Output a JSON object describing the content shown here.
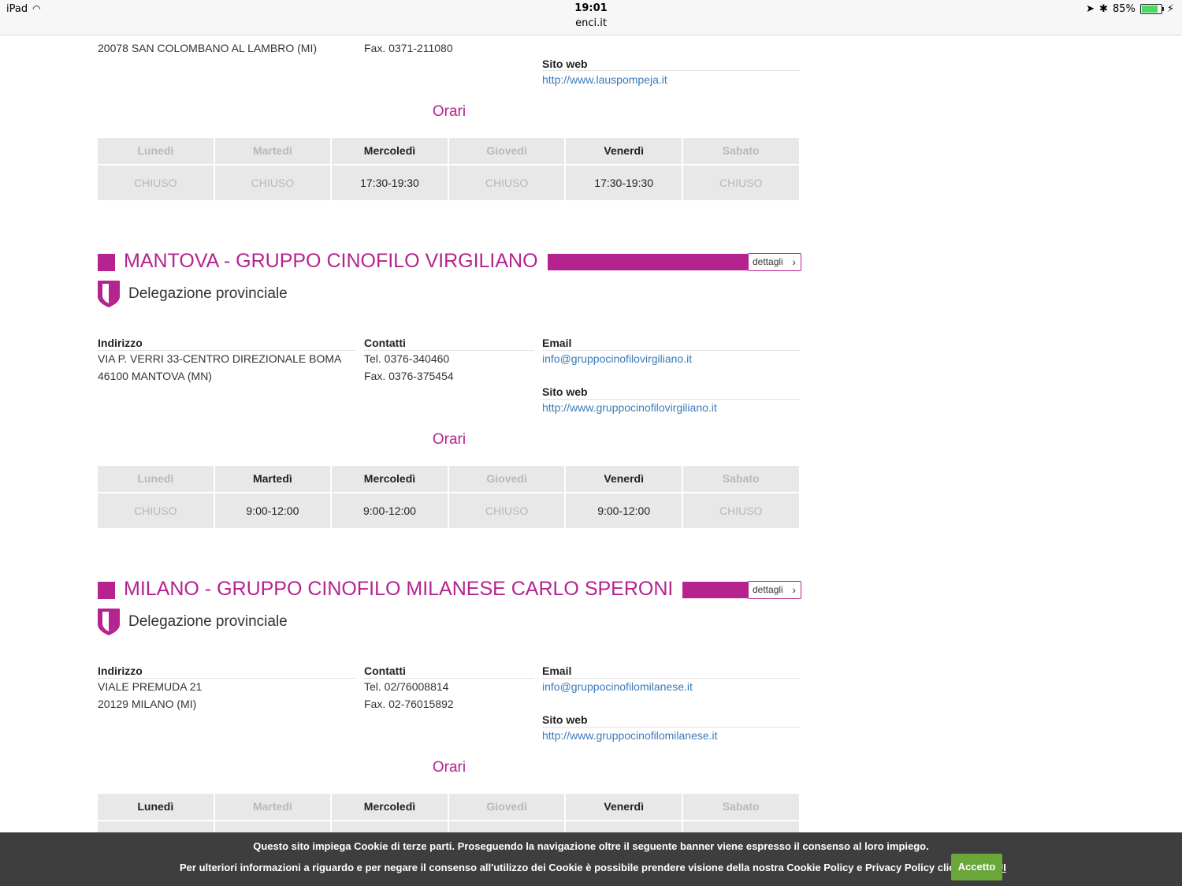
{
  "statusbar": {
    "device": "iPad",
    "time": "19:01",
    "url": "enci.it",
    "battery": "85%"
  },
  "partial": {
    "address_line2": "20078 SAN COLOMBANO AL LAMBRO (MI)",
    "fax": "Fax. 0371-211080",
    "site_label": "Sito web",
    "site": "http://www.lauspompeja.it",
    "orari": "Orari",
    "hours": [
      {
        "day": "Lunedì",
        "value": "CHIUSO",
        "open": false
      },
      {
        "day": "Martedì",
        "value": "CHIUSO",
        "open": false
      },
      {
        "day": "Mercoledì",
        "value": "17:30-19:30",
        "open": true
      },
      {
        "day": "Giovedì",
        "value": "CHIUSO",
        "open": false
      },
      {
        "day": "Venerdì",
        "value": "17:30-19:30",
        "open": true
      },
      {
        "day": "Sabato",
        "value": "CHIUSO",
        "open": false
      }
    ]
  },
  "mantova": {
    "title": "MANTOVA - GRUPPO CINOFILO VIRGILIANO",
    "details": "dettagli",
    "type": "Delegazione provinciale",
    "address_label": "Indirizzo",
    "address_line1": "VIA P. VERRI 33-CENTRO DIREZIONALE BOMA",
    "address_line2": "46100 MANTOVA (MN)",
    "contacts_label": "Contatti",
    "tel": "Tel. 0376-340460",
    "fax": "Fax. 0376-375454",
    "email_label": "Email",
    "email": "info@gruppocinofilovirgiliano.it",
    "site_label": "Sito web",
    "site": "http://www.gruppocinofilovirgiliano.it",
    "orari": "Orari",
    "hours": [
      {
        "day": "Lunedì",
        "value": "CHIUSO",
        "open": false
      },
      {
        "day": "Martedì",
        "value": "9:00-12:00",
        "open": true
      },
      {
        "day": "Mercoledì",
        "value": "9:00-12:00",
        "open": true
      },
      {
        "day": "Giovedì",
        "value": "CHIUSO",
        "open": false
      },
      {
        "day": "Venerdì",
        "value": "9:00-12:00",
        "open": true
      },
      {
        "day": "Sabato",
        "value": "CHIUSO",
        "open": false
      }
    ]
  },
  "milano": {
    "title": "MILANO - GRUPPO CINOFILO MILANESE CARLO SPERONI",
    "details": "dettagli",
    "type": "Delegazione provinciale",
    "address_label": "Indirizzo",
    "address_line1": "VIALE PREMUDA 21",
    "address_line2": "20129 MILANO (MI)",
    "contacts_label": "Contatti",
    "tel": "Tel. 02/76008814",
    "fax": "Fax. 02-76015892",
    "email_label": "Email",
    "email": "info@gruppocinofilomilanese.it",
    "site_label": "Sito web",
    "site": "http://www.gruppocinofilomilanese.it",
    "orari": "Orari",
    "hours": [
      {
        "day": "Lunedì",
        "open": true
      },
      {
        "day": "Martedì",
        "open": false
      },
      {
        "day": "Mercoledì",
        "open": true
      },
      {
        "day": "Giovedì",
        "open": false
      },
      {
        "day": "Venerdì",
        "open": true
      },
      {
        "day": "Sabato",
        "open": false
      }
    ]
  },
  "cookie": {
    "line1": "Questo sito impiega Cookie di terze parti. Proseguendo la navigazione oltre il seguente banner viene espresso il consenso al loro impiego.",
    "line2": "Per ulteriori informazioni a riguardo e per negare il consenso all'utilizzo dei Cookie è possibile prendere visione della nostra Cookie Policy e Privacy Policy cliccando",
    "link": "QUI",
    "accept": "Accetto"
  },
  "colors": {
    "accent": "#b5238f",
    "link": "#3a7ab8",
    "accept": "#6aa63a",
    "cookie_bg": "#3e3e3e"
  }
}
